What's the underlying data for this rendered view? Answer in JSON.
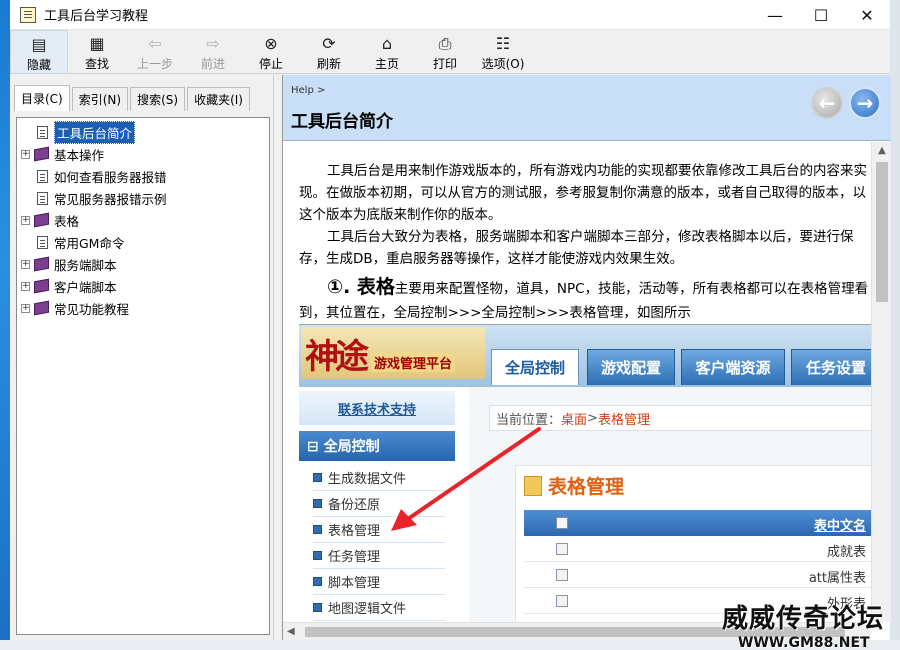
{
  "window": {
    "title": "工具后台学习教程",
    "minimize": "—",
    "maximize": "☐",
    "close": "✕"
  },
  "toolbar": {
    "hide": "隐藏",
    "find": "查找",
    "back": "上一步",
    "forward": "前进",
    "stop": "停止",
    "refresh": "刷新",
    "home": "主页",
    "print": "打印",
    "options": "选项(O)"
  },
  "tabs": [
    "目录(C)",
    "索引(N)",
    "搜索(S)",
    "收藏夹(I)"
  ],
  "tree": [
    {
      "label": "工具后台简介",
      "type": "doc",
      "selected": true
    },
    {
      "label": "基本操作",
      "type": "book"
    },
    {
      "label": "如何查看服务器报错",
      "type": "doc"
    },
    {
      "label": "常见服务器报错示例",
      "type": "doc"
    },
    {
      "label": "表格",
      "type": "book"
    },
    {
      "label": "常用GM命令",
      "type": "doc"
    },
    {
      "label": "服务端脚本",
      "type": "book"
    },
    {
      "label": "客户端脚本",
      "type": "book"
    },
    {
      "label": "常见功能教程",
      "type": "book"
    }
  ],
  "content": {
    "breadcrumb": "Help >",
    "title": "工具后台简介",
    "para1": "工具后台是用来制作游戏版本的，所有游戏内功能的实现都要依靠修改工具后台的内容来实现。在做版本初期，可以从官方的测试服，参考服复制你满意的版本，或者自己取得的版本，以这个版本为底版来制作你的版本。",
    "para2": "工具后台大致分为表格，服务端脚本和客户端脚本三部分，修改表格脚本以后，要进行保存，生成DB，重启服务器等操作，这样才能使游戏内效果生效。",
    "section_heading": "①. 表格",
    "section_text": "主要用来配置怪物，道具，NPC，技能，活动等，所有表格都可以在表格管理看到，其位置在，全局控制>>>全局控制>>>表格管理，如图所示"
  },
  "screenshot": {
    "logo_calli": "神途",
    "logo_sub": "游戏管理平台",
    "tabs": [
      "全局控制",
      "游戏配置",
      "客户端资源",
      "任务设置"
    ],
    "contact": "联系技术支持",
    "group": "⊟ 全局控制",
    "items": [
      "生成数据文件",
      "备份还原",
      "表格管理",
      "任务管理",
      "脚本管理",
      "地图逻辑文件"
    ],
    "crumb_prefix": "当前位置：",
    "crumb_home": "桌面",
    "crumb_sep": " > ",
    "crumb_page": "表格管理",
    "panel_title": "表格管理",
    "table_header": "表中文名",
    "rows": [
      "成就表",
      "att属性表",
      "外形表"
    ]
  },
  "watermark": {
    "line1": "威威传奇论坛",
    "line2": "WWW.GM88.NET"
  }
}
